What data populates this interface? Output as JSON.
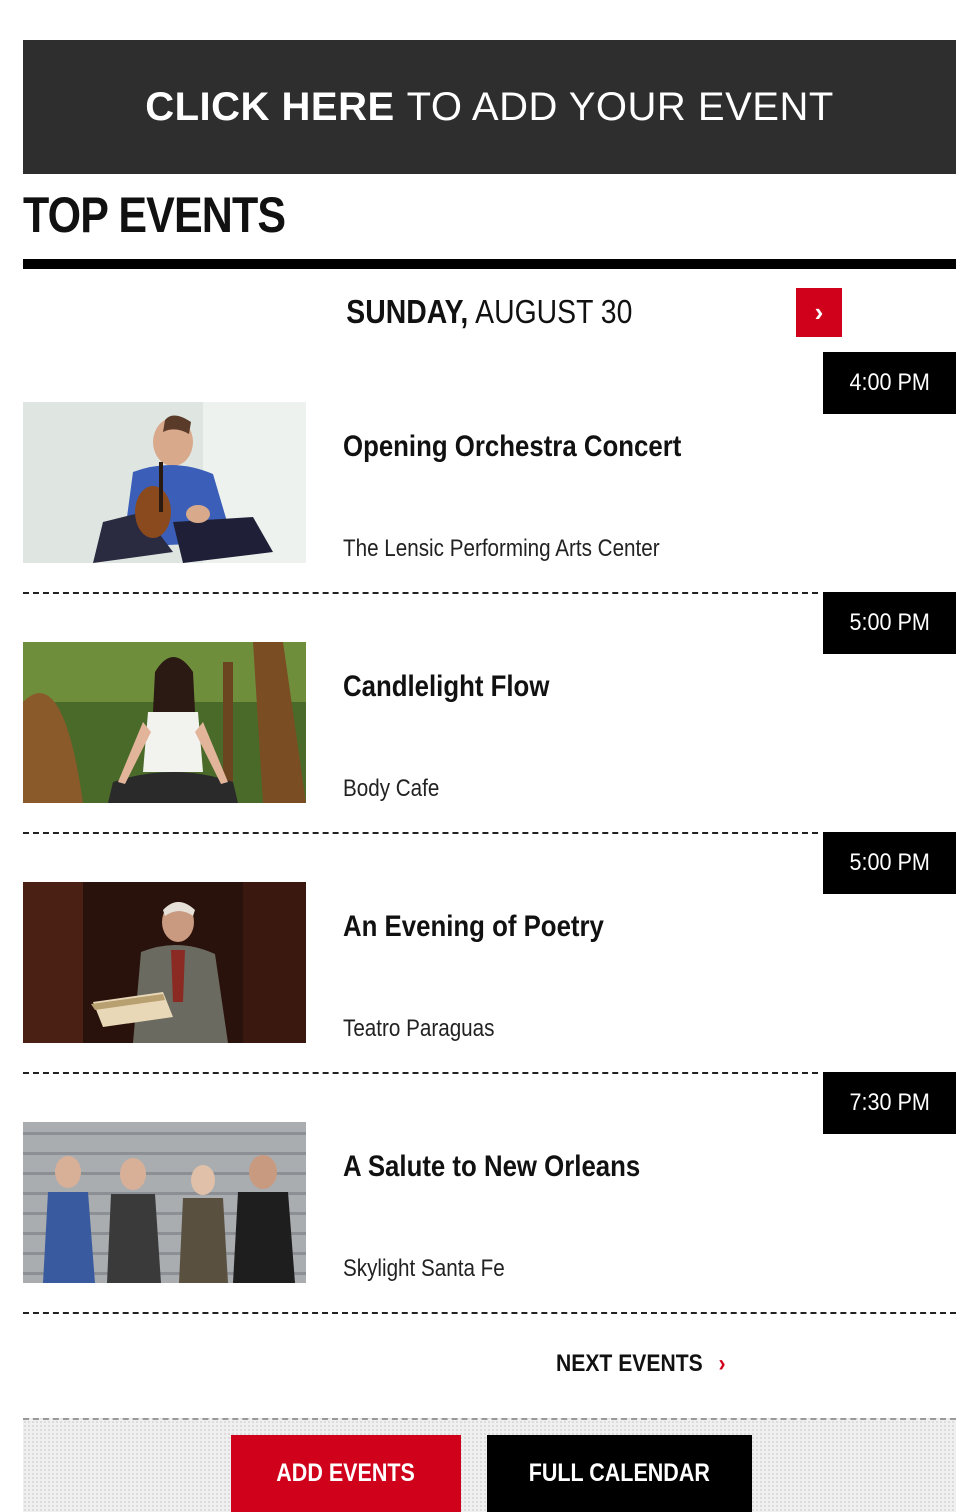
{
  "banner": {
    "strong": "CLICK HERE",
    "light": "TO ADD YOUR EVENT"
  },
  "section_title": "TOP EVENTS",
  "date": {
    "day": "SUNDAY,",
    "month_day": "AUGUST 30",
    "next_icon": "›"
  },
  "events": [
    {
      "time": "4:00 PM",
      "title": "Opening Orchestra Concert",
      "venue": "The Lensic Performing Arts Center",
      "image_icon": "violinist-photo"
    },
    {
      "time": "5:00 PM",
      "title": "Candlelight Flow",
      "venue": "Body Cafe",
      "image_icon": "yoga-photo"
    },
    {
      "time": "5:00 PM",
      "title": "An Evening of Poetry",
      "venue": "Teatro Paraguas",
      "image_icon": "poet-reading-photo"
    },
    {
      "time": "7:30 PM",
      "title": "A Salute to New Orleans",
      "venue": "Skylight Santa Fe",
      "image_icon": "band-photo"
    }
  ],
  "next_events": {
    "label": "NEXT EVENTS",
    "icon": "›"
  },
  "footer": {
    "add_events": "ADD EVENTS",
    "full_calendar": "FULL CALENDAR"
  },
  "colors": {
    "accent": "#d0021b",
    "banner_bg": "#2e2e2e",
    "time_bg": "#000000"
  }
}
